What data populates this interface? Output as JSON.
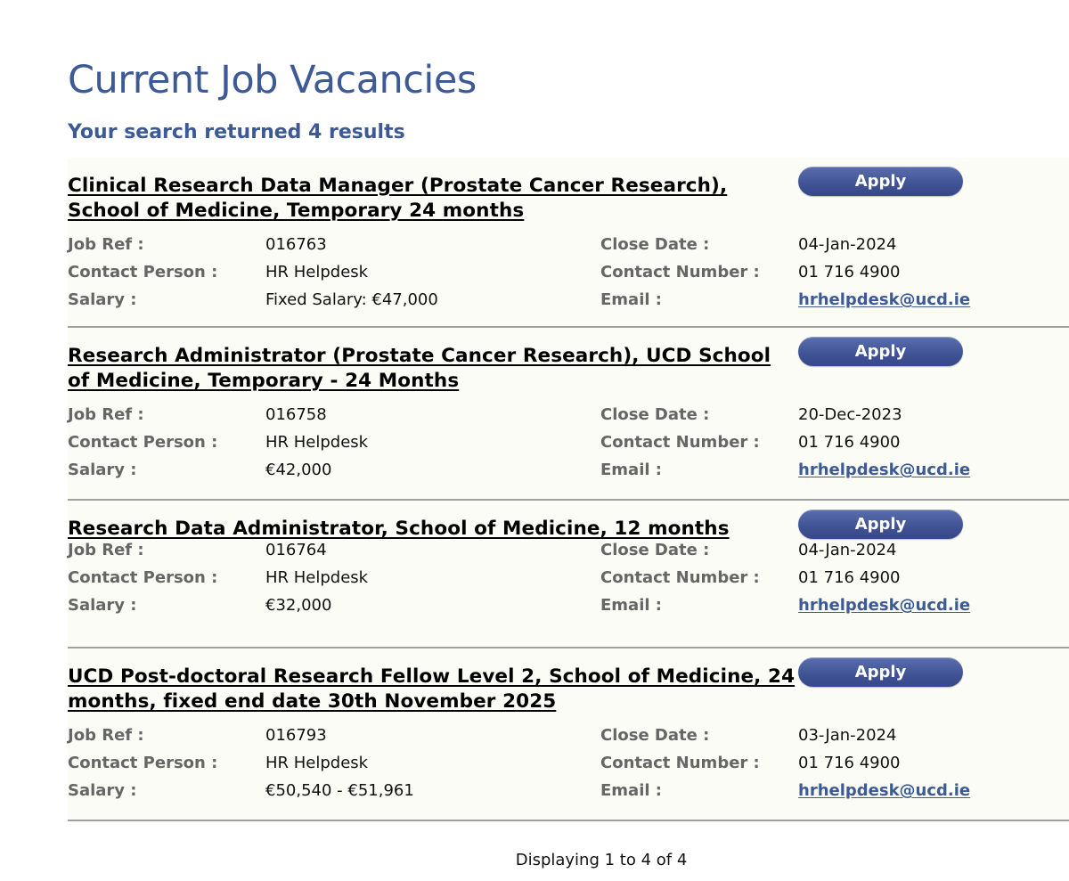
{
  "page": {
    "title": "Current Job Vacancies",
    "results": "Your search returned 4 results",
    "pagination": "Displaying 1 to 4 of 4"
  },
  "labels": {
    "job_ref": "Job Ref :",
    "contact_person": "Contact Person :",
    "salary": "Salary :",
    "close_date": "Close Date :",
    "contact_number": "Contact Number :",
    "email": "Email :",
    "apply": "Apply"
  },
  "jobs": [
    {
      "title": "Clinical Research Data Manager (Prostate Cancer Research), School of Medicine, Temporary 24 months",
      "job_ref": "016763",
      "contact_person": "HR Helpdesk",
      "salary": "Fixed Salary: €47,000",
      "close_date": "04-Jan-2024",
      "contact_number": "01 716 4900",
      "email": "hrhelpdesk@ucd.ie"
    },
    {
      "title": "Research Administrator (Prostate Cancer Research), UCD School of Medicine, Temporary - 24 Months",
      "job_ref": "016758",
      "contact_person": "HR Helpdesk",
      "salary": "€42,000",
      "close_date": "20-Dec-2023",
      "contact_number": "01 716 4900",
      "email": "hrhelpdesk@ucd.ie"
    },
    {
      "title": "Research Data Administrator, School of Medicine, 12 months",
      "job_ref": "016764",
      "contact_person": "HR Helpdesk",
      "salary": "€32,000",
      "close_date": "04-Jan-2024",
      "contact_number": "01 716 4900",
      "email": "hrhelpdesk@ucd.ie"
    },
    {
      "title": "UCD Post-doctoral Research Fellow Level 2, School of Medicine, 24 months, fixed end date 30th November 2025",
      "job_ref": "016793",
      "contact_person": "HR Helpdesk",
      "salary": "€50,540 - €51,961",
      "close_date": "03-Jan-2024",
      "contact_number": "01 716 4900",
      "email": "hrhelpdesk@ucd.ie"
    }
  ]
}
